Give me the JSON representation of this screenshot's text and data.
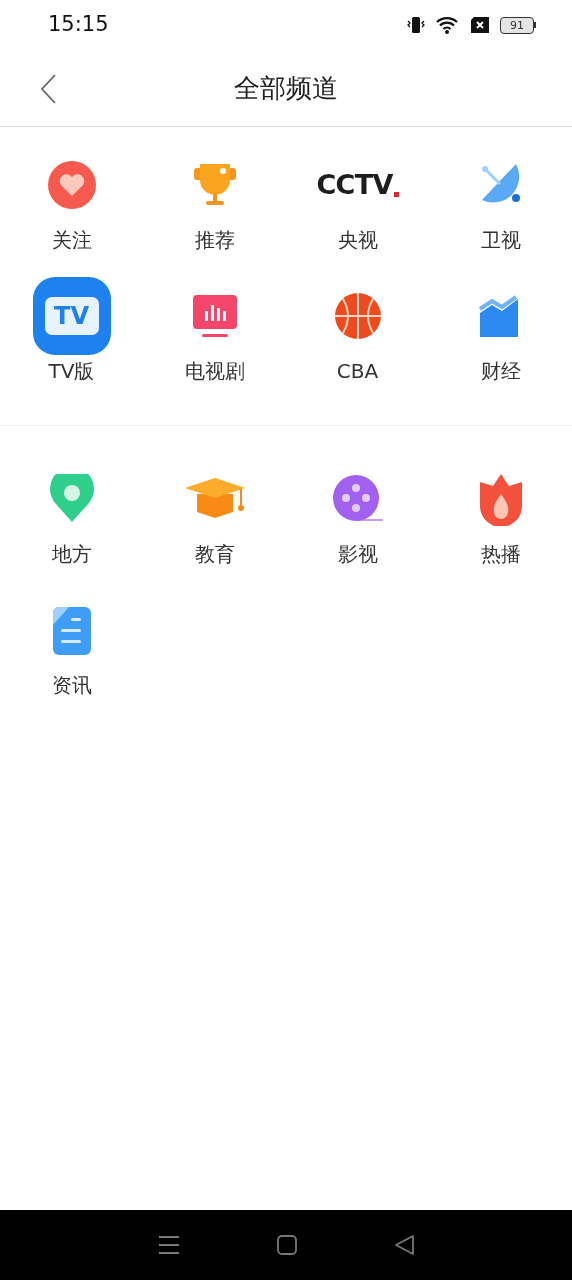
{
  "status_bar": {
    "time": "15:15",
    "battery": "91"
  },
  "header": {
    "title": "全部频道"
  },
  "sections": [
    {
      "channels": [
        {
          "label": "关注",
          "kind": "heart"
        },
        {
          "label": "推荐",
          "kind": "trophy"
        },
        {
          "label": "央视",
          "kind": "logo",
          "logo_text": "CCTV"
        },
        {
          "label": "卫视",
          "kind": "satellite"
        },
        {
          "label": "TV版",
          "kind": "tv",
          "icon_text": "TV"
        },
        {
          "label": "电视剧",
          "kind": "monitor"
        },
        {
          "label": "CBA",
          "kind": "basketball"
        },
        {
          "label": "财经",
          "kind": "chart"
        }
      ]
    },
    {
      "channels": [
        {
          "label": "地方",
          "kind": "pin"
        },
        {
          "label": "教育",
          "kind": "cap"
        },
        {
          "label": "影视",
          "kind": "reel"
        },
        {
          "label": "热播",
          "kind": "flame"
        },
        {
          "label": "资讯",
          "kind": "document"
        }
      ]
    }
  ]
}
